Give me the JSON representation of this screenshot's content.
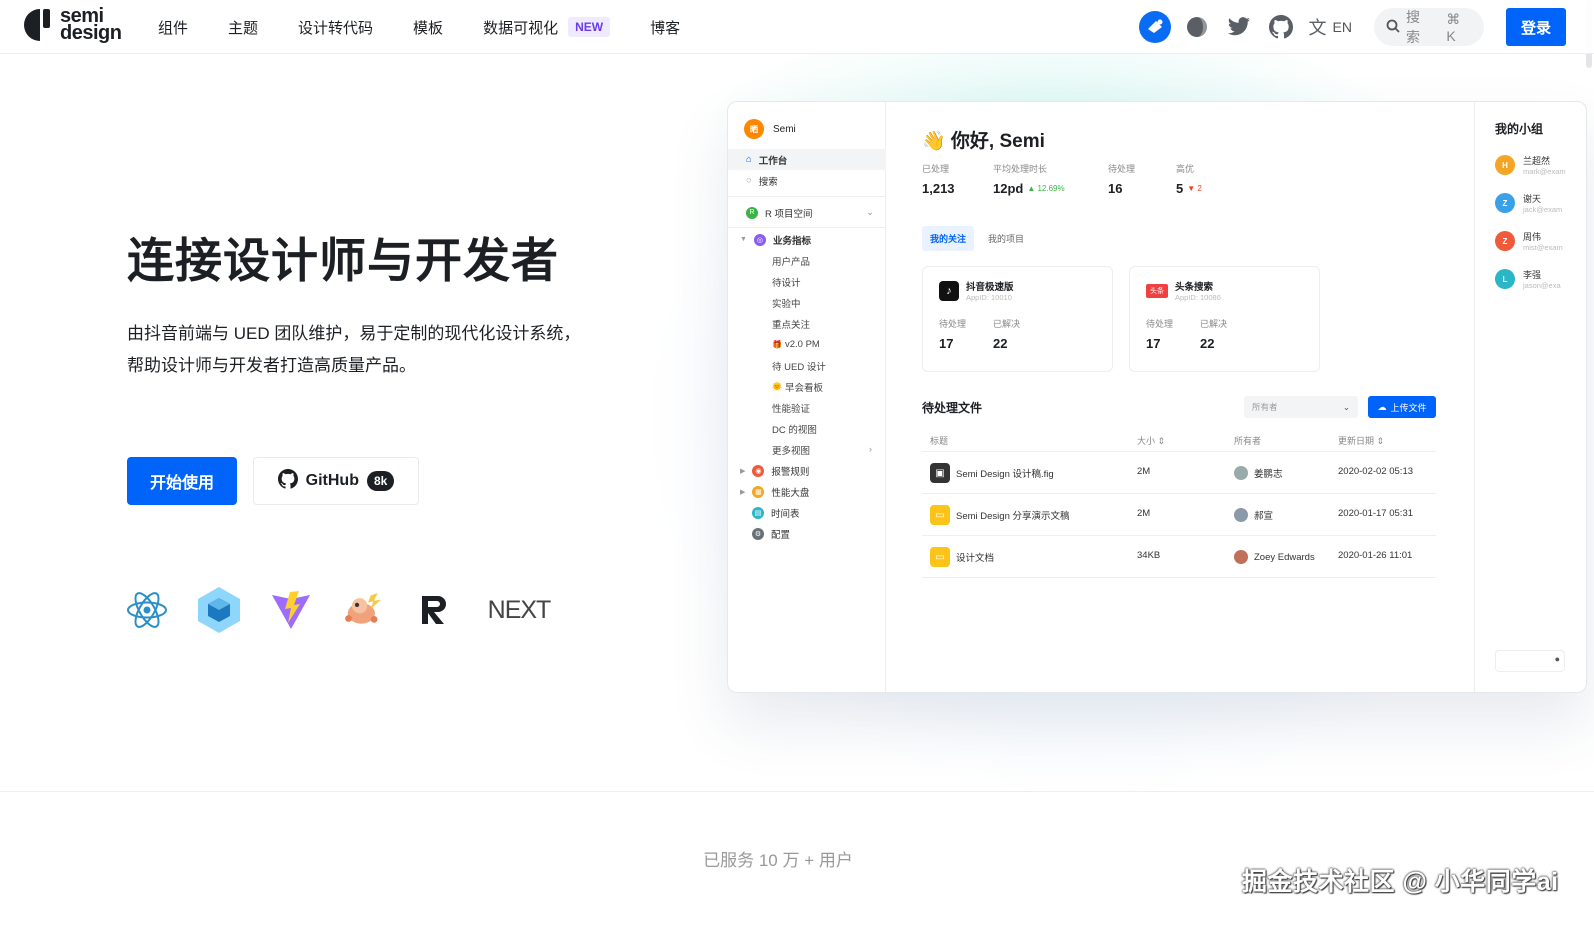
{
  "nav": {
    "logo_line1": "semi",
    "logo_line2": "design",
    "menu": [
      "组件",
      "主题",
      "设计转代码",
      "模板",
      "数据可视化",
      "博客"
    ],
    "new_badge": "NEW",
    "lang": "EN",
    "search_label": "搜索",
    "search_shortcut": "⌘ K",
    "login": "登录"
  },
  "hero": {
    "title": "连接设计师与开发者",
    "desc_line1": "由抖音前端与 UED 团队维护，易于定制的现代化设计系统，",
    "desc_line2": "帮助设计师与开发者打造高质量产品。",
    "start": "开始使用",
    "github": "GitHub",
    "github_count": "8k",
    "techs": [
      "react-icon",
      "webpack-icon",
      "vite-icon",
      "rspack-icon",
      "remix-icon",
      "nextjs-icon"
    ],
    "next_text": "NEXT"
  },
  "mock": {
    "user": {
      "avatar": "晒",
      "name": "Semi"
    },
    "nav": {
      "workspace": "工作台",
      "search": "搜索",
      "project": "R 项目空间",
      "project_badge": "R"
    },
    "metrics_group": "业务指标",
    "sub_items": [
      "用户产品",
      "待设计",
      "实验中",
      "重点关注",
      "v2.0 PM",
      "待 UED 设计",
      "早会看板",
      "性能验证",
      "DC 的视图",
      "更多视图"
    ],
    "bottom_items": [
      "报警规则",
      "性能大盘",
      "时间表",
      "配置"
    ],
    "greeting": "👋 你好, Semi",
    "stats": [
      {
        "label": "已处理",
        "value": "1,213",
        "delta": ""
      },
      {
        "label": "平均处理时长",
        "value": "12pd",
        "delta": "▲ 12.69%"
      },
      {
        "label": "待处理",
        "value": "16",
        "delta": ""
      },
      {
        "label": "高优",
        "value": "5",
        "delta": "▼ 2"
      }
    ],
    "tabs": [
      "我的关注",
      "我的项目"
    ],
    "cards": [
      {
        "name": "抖音极速版",
        "id": "AppID: 10010",
        "l1": "待处理",
        "v1": "17",
        "l2": "已解决",
        "v2": "22"
      },
      {
        "name": "头条搜索",
        "id": "AppID: 10086",
        "l1": "待处理",
        "v1": "17",
        "l2": "已解决",
        "v2": "22",
        "logo": "头条"
      }
    ],
    "files_title": "待处理文件",
    "owner_placeholder": "所有者",
    "upload": "上传文件",
    "columns": [
      "标题",
      "大小 ⇕",
      "所有者",
      "更新日期 ⇕"
    ],
    "rows": [
      {
        "title": "Semi Design 设计稿.fig",
        "size": "2M",
        "owner": "姜鹏志",
        "date": "2020-02-02 05:13"
      },
      {
        "title": "Semi Design 分享演示文稿",
        "size": "2M",
        "owner": "郝宣",
        "date": "2020-01-17 05:31"
      },
      {
        "title": "设计文档",
        "size": "34KB",
        "owner": "Zoey Edwards",
        "date": "2020-01-26 11:01"
      }
    ],
    "group_title": "我的小组",
    "members": [
      {
        "initial": "H",
        "name": "兰超然",
        "mail": "mark@exam",
        "color": "#f5a524"
      },
      {
        "initial": "Z",
        "name": "谢天",
        "mail": "jack@exam",
        "color": "#3aa0e8"
      },
      {
        "initial": "Z",
        "name": "周伟",
        "mail": "mist@exam",
        "color": "#f05a3a"
      },
      {
        "initial": "L",
        "name": "李强",
        "mail": "jason@exa",
        "color": "#2bb6c8"
      }
    ]
  },
  "footer": {
    "served": "已服务 10 万 + 用户",
    "watermark": "掘金技术社区 @ 小华同学ai"
  },
  "colors": {
    "primary": "#0064fa",
    "new_badge": "#6a3de8",
    "up": "#3bb346",
    "down": "#f93920"
  }
}
